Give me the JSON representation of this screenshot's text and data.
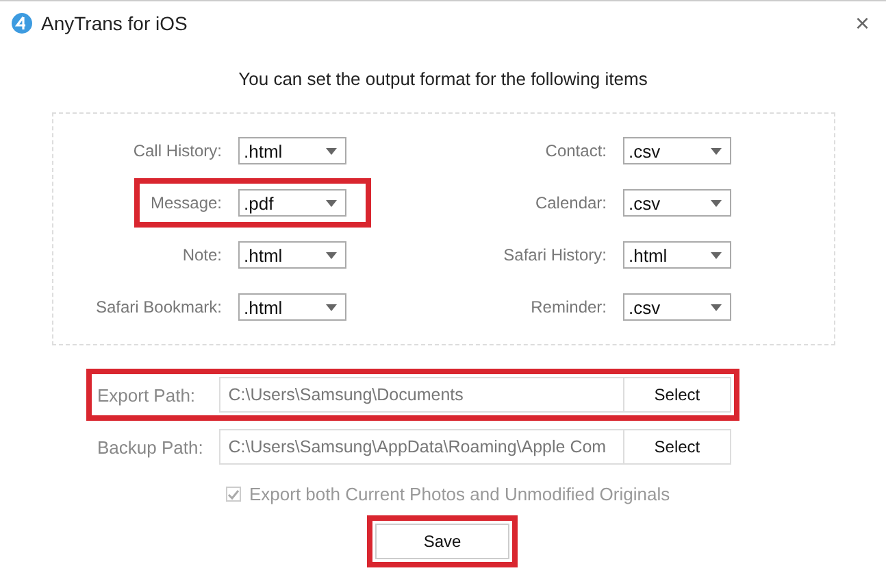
{
  "window": {
    "title": "AnyTrans for iOS",
    "close": "×"
  },
  "heading": "You can set the output format for the following items",
  "formats": [
    {
      "label": "Call History:",
      "value": ".html",
      "highlighted": false
    },
    {
      "label": "Contact:",
      "value": ".csv",
      "highlighted": false
    },
    {
      "label": "Message:",
      "value": ".pdf",
      "highlighted": true
    },
    {
      "label": "Calendar:",
      "value": ".csv",
      "highlighted": false
    },
    {
      "label": "Note:",
      "value": ".html",
      "highlighted": false
    },
    {
      "label": "Safari History:",
      "value": ".html",
      "highlighted": false
    },
    {
      "label": "Safari Bookmark:",
      "value": ".html",
      "highlighted": false
    },
    {
      "label": "Reminder:",
      "value": ".csv",
      "highlighted": false
    }
  ],
  "paths": [
    {
      "label": "Export Path:",
      "value": "C:\\Users\\Samsung\\Documents",
      "button": "Select",
      "highlighted": true
    },
    {
      "label": "Backup Path:",
      "value": "C:\\Users\\Samsung\\AppData\\Roaming\\Apple Com",
      "button": "Select",
      "highlighted": false
    }
  ],
  "option": {
    "label": "Export both Current Photos and Unmodified Originals",
    "checked": true,
    "disabled": true
  },
  "save": {
    "label": "Save",
    "highlighted": true
  }
}
